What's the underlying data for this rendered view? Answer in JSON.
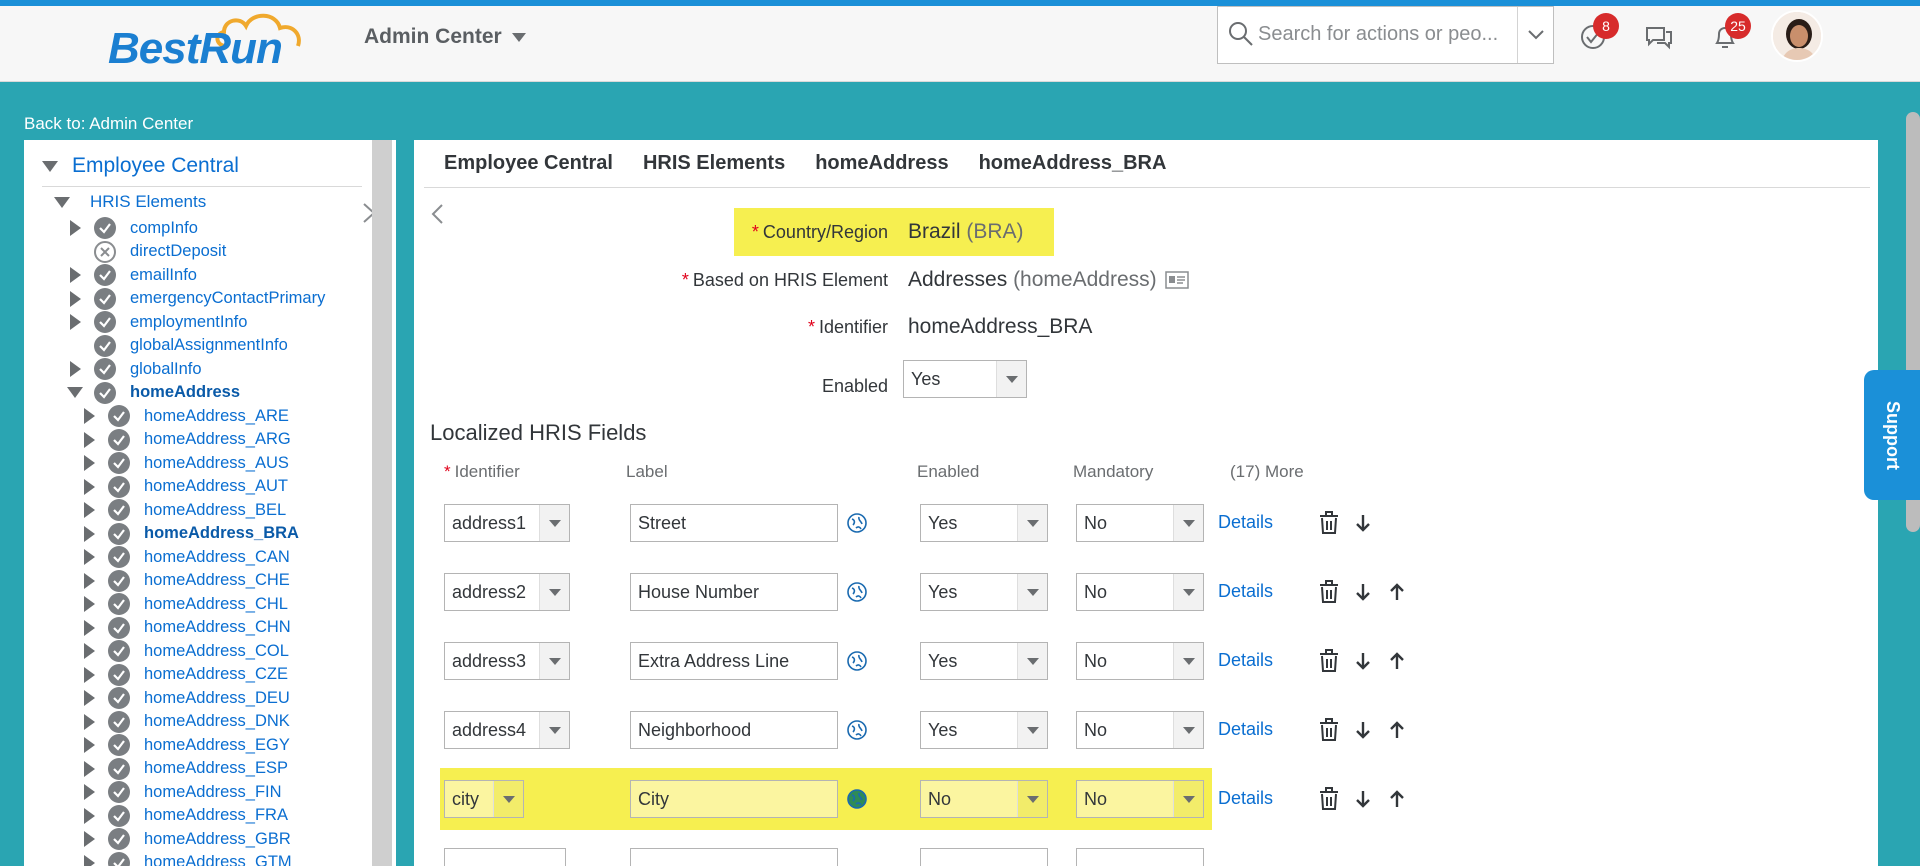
{
  "shell": {
    "logo_text": "BestRun",
    "menu_label": "Admin Center",
    "search_placeholder": "Search for actions or peo...",
    "todo_count": "8",
    "notification_count": "25"
  },
  "back_link": "Back to: Admin Center",
  "tree": {
    "root": "Employee Central",
    "group": "HRIS Elements",
    "items": [
      {
        "label": "compInfo",
        "expand": true,
        "status": "check",
        "level": 1
      },
      {
        "label": "directDeposit",
        "expand": false,
        "status": "x",
        "level": 1
      },
      {
        "label": "emailInfo",
        "expand": true,
        "status": "check",
        "level": 1
      },
      {
        "label": "emergencyContactPrimary",
        "expand": true,
        "status": "check",
        "level": 1
      },
      {
        "label": "employmentInfo",
        "expand": true,
        "status": "check",
        "level": 1
      },
      {
        "label": "globalAssignmentInfo",
        "expand": false,
        "status": "check",
        "level": 1
      },
      {
        "label": "globalInfo",
        "expand": true,
        "status": "check",
        "level": 1
      },
      {
        "label": "homeAddress",
        "expand": "open",
        "status": "check",
        "level": 1,
        "bold": true
      },
      {
        "label": "homeAddress_ARE",
        "expand": true,
        "status": "check",
        "level": 2
      },
      {
        "label": "homeAddress_ARG",
        "expand": true,
        "status": "check",
        "level": 2
      },
      {
        "label": "homeAddress_AUS",
        "expand": true,
        "status": "check",
        "level": 2
      },
      {
        "label": "homeAddress_AUT",
        "expand": true,
        "status": "check",
        "level": 2
      },
      {
        "label": "homeAddress_BEL",
        "expand": true,
        "status": "check",
        "level": 2
      },
      {
        "label": "homeAddress_BRA",
        "expand": true,
        "status": "check",
        "level": 2,
        "bold": true
      },
      {
        "label": "homeAddress_CAN",
        "expand": true,
        "status": "check",
        "level": 2
      },
      {
        "label": "homeAddress_CHE",
        "expand": true,
        "status": "check",
        "level": 2
      },
      {
        "label": "homeAddress_CHL",
        "expand": true,
        "status": "check",
        "level": 2
      },
      {
        "label": "homeAddress_CHN",
        "expand": true,
        "status": "check",
        "level": 2
      },
      {
        "label": "homeAddress_COL",
        "expand": true,
        "status": "check",
        "level": 2
      },
      {
        "label": "homeAddress_CZE",
        "expand": true,
        "status": "check",
        "level": 2
      },
      {
        "label": "homeAddress_DEU",
        "expand": true,
        "status": "check",
        "level": 2
      },
      {
        "label": "homeAddress_DNK",
        "expand": true,
        "status": "check",
        "level": 2
      },
      {
        "label": "homeAddress_EGY",
        "expand": true,
        "status": "check",
        "level": 2
      },
      {
        "label": "homeAddress_ESP",
        "expand": true,
        "status": "check",
        "level": 2
      },
      {
        "label": "homeAddress_FIN",
        "expand": true,
        "status": "check",
        "level": 2
      },
      {
        "label": "homeAddress_FRA",
        "expand": true,
        "status": "check",
        "level": 2
      },
      {
        "label": "homeAddress_GBR",
        "expand": true,
        "status": "check",
        "level": 2
      },
      {
        "label": "homeAddress_GTM",
        "expand": true,
        "status": "check",
        "level": 2
      }
    ]
  },
  "breadcrumbs": [
    "Employee Central",
    "HRIS Elements",
    "homeAddress",
    "homeAddress_BRA"
  ],
  "form": {
    "country_label": "Country/Region",
    "country_value": "Brazil",
    "country_code": "(BRA)",
    "based_on_label": "Based on HRIS Element",
    "based_on_value": "Addresses",
    "based_on_id": "(homeAddress)",
    "identifier_label": "Identifier",
    "identifier_value": "homeAddress_BRA",
    "enabled_label": "Enabled",
    "enabled_value": "Yes"
  },
  "fields_section": {
    "title": "Localized HRIS Fields",
    "headers": {
      "identifier": "Identifier",
      "label": "Label",
      "enabled": "Enabled",
      "mandatory": "Mandatory",
      "more": "(17) More"
    },
    "details_label": "Details",
    "rows": [
      {
        "identifier": "address1",
        "label": "Street",
        "enabled": "Yes",
        "mandatory": "No",
        "highlight": false,
        "up": false
      },
      {
        "identifier": "address2",
        "label": "House Number",
        "enabled": "Yes",
        "mandatory": "No",
        "highlight": false,
        "up": true
      },
      {
        "identifier": "address3",
        "label": "Extra Address Line",
        "enabled": "Yes",
        "mandatory": "No",
        "highlight": false,
        "up": true
      },
      {
        "identifier": "address4",
        "label": "Neighborhood",
        "enabled": "Yes",
        "mandatory": "No",
        "highlight": false,
        "up": true
      },
      {
        "identifier": "city",
        "label": "City",
        "enabled": "No",
        "mandatory": "No",
        "highlight": true,
        "up": true
      }
    ]
  },
  "support_label": "Support",
  "colors": {
    "shell_blue": "#1b90d8",
    "teal_background": "#2aa5b2",
    "link_blue": "#0a6ed1",
    "highlight_yellow": "#f6ef50",
    "badge_red": "#d72b2b"
  }
}
